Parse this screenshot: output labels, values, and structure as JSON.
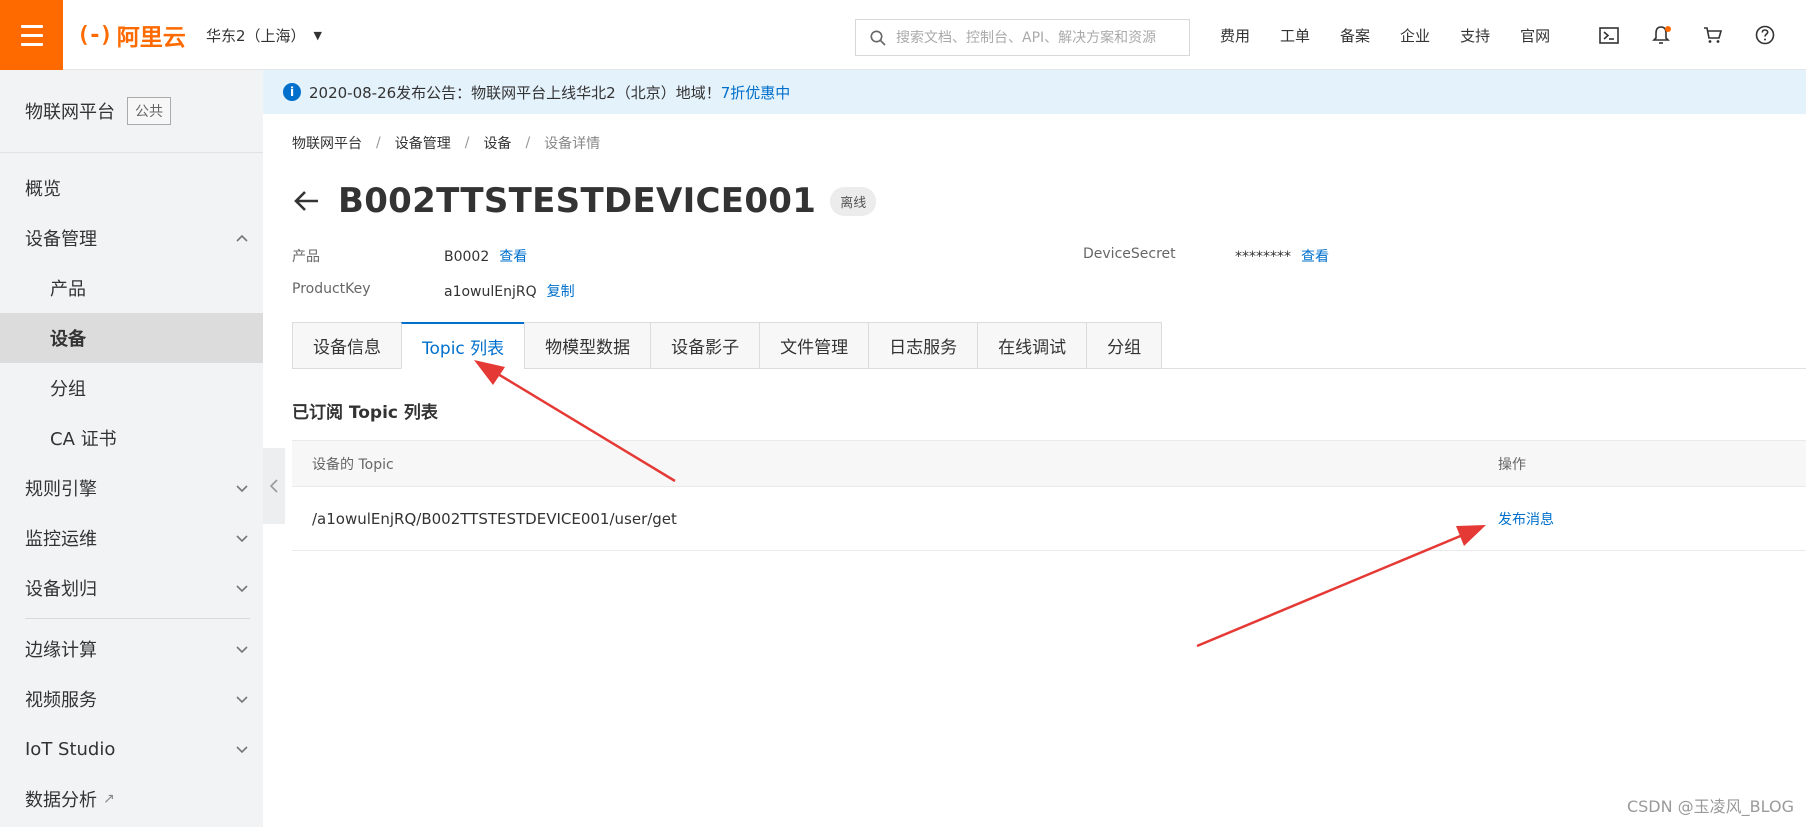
{
  "header": {
    "brand_mark": "(-)",
    "brand_name": "阿里云",
    "region": "华东2（上海）",
    "search_placeholder": "搜索文档、控制台、API、解决方案和资源",
    "nav": [
      "费用",
      "工单",
      "备案",
      "企业",
      "支持",
      "官网"
    ],
    "icons": [
      "terminal-icon",
      "bell-icon",
      "cart-icon",
      "help-icon"
    ],
    "accent_color": "#ff6a00"
  },
  "sidebar": {
    "title": "物联网平台",
    "badge": "公共",
    "items": [
      {
        "label": "概览"
      },
      {
        "label": "设备管理",
        "expanded": true
      },
      {
        "label": "产品"
      },
      {
        "label": "设备",
        "active": true
      },
      {
        "label": "分组"
      },
      {
        "label": "CA 证书"
      },
      {
        "label": "规则引擎"
      },
      {
        "label": "监控运维"
      },
      {
        "label": "设备划归"
      },
      {
        "label": "边缘计算"
      },
      {
        "label": "视频服务"
      },
      {
        "label": "IoT Studio"
      },
      {
        "label": "数据分析"
      }
    ]
  },
  "notice": {
    "text": "2020-08-26发布公告：物联网平台上线华北2（北京）地域！",
    "link": "7折优惠中"
  },
  "breadcrumb": [
    "物联网平台",
    "设备管理",
    "设备",
    "设备详情"
  ],
  "device": {
    "name": "B002TTSTESTDEVICE001",
    "status": "离线",
    "product_label": "产品",
    "product_value": "B0002",
    "product_link": "查看",
    "productkey_label": "ProductKey",
    "productkey_value": "a1owulEnjRQ",
    "productkey_link": "复制",
    "secret_label": "DeviceSecret",
    "secret_value": "********",
    "secret_link": "查看"
  },
  "tabs": [
    {
      "label": "设备信息"
    },
    {
      "label": "Topic 列表",
      "active": true
    },
    {
      "label": "物模型数据"
    },
    {
      "label": "设备影子"
    },
    {
      "label": "文件管理"
    },
    {
      "label": "日志服务"
    },
    {
      "label": "在线调试"
    },
    {
      "label": "分组"
    }
  ],
  "topics": {
    "section_title": "已订阅 Topic 列表",
    "columns": [
      "设备的 Topic",
      "操作"
    ],
    "rows": [
      {
        "topic": "/a1owulEnjRQ/B002TTSTESTDEVICE001/user/get",
        "action": "发布消息"
      }
    ]
  },
  "annotation_color": "#e53935",
  "watermark": "CSDN @玉凌风_BLOG"
}
